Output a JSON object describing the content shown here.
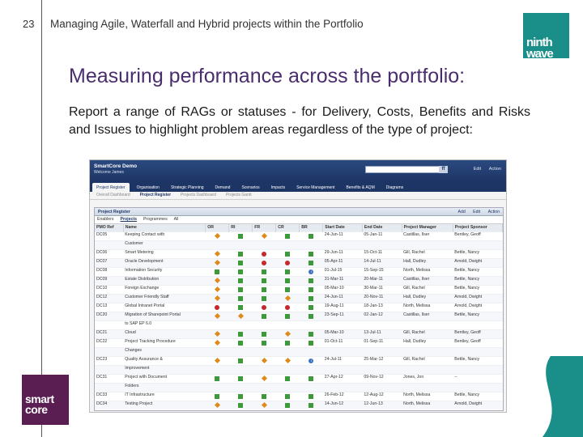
{
  "slide": {
    "page_number": "23",
    "header": "Managing Agile, Waterfall and Hybrid projects within the Portfolio",
    "title": "Measuring performance across the portfolio:",
    "intro": "Report a range of RAGs or statuses - for Delivery, Costs, Benefits and Risks and Issues to highlight problem areas regardless of the type of project:",
    "brand_right": [
      "ninth",
      "wave"
    ],
    "brand_left": [
      "smart",
      "core"
    ],
    "colors": {
      "title": "#4a2d6d",
      "brand_right": "#1a8f8a",
      "brand_left": "#5a1e52"
    }
  },
  "app": {
    "title": "SmartCore Demo",
    "welcome": "Welcome James",
    "search_placeholder": "",
    "search_button": "ff",
    "top_links": [
      "Edit",
      "Action"
    ],
    "nav": [
      "Project Register",
      "Organisation",
      "Strategic Planning",
      "Demand",
      "Scenarios",
      "Impacts",
      "Service Management",
      "Benefits & AQM",
      "Diagrams"
    ],
    "nav_active": 0,
    "subnav": [
      "Overall Dashboard",
      "Project Register",
      "Projects Dashboard",
      "Projects Gantt"
    ],
    "subnav_active": 1,
    "panel_title": "Project Register",
    "panel_actions": [
      "Add",
      "Edit",
      "Action"
    ],
    "filter_tabs": [
      "Enablers",
      "Projects",
      "Programmes",
      "All"
    ],
    "filter_active": 1,
    "columns": [
      "PMO Ref",
      "Name",
      "OR",
      "RI",
      "FR",
      "CR",
      "BR",
      "Start Date",
      "End Date",
      "Project Manager",
      "Project Sponsor"
    ],
    "rows": [
      {
        "ref": "DC05",
        "name": "Keeping Contact with",
        "rag": [
          "amber",
          "green",
          "amber",
          "green",
          "green"
        ],
        "start": "24-Jun-11",
        "end": "05-Jan-11",
        "pm": "Castillas, Ilser",
        "sponsor": "Bentley, Geoff"
      },
      {
        "ref": "",
        "name": "Customer",
        "rag": [
          "none",
          "none",
          "none",
          "none",
          "none"
        ],
        "start": "",
        "end": "",
        "pm": "",
        "sponsor": ""
      },
      {
        "ref": "DC06",
        "name": "Smart Metering",
        "rag": [
          "amber",
          "green",
          "red",
          "green",
          "green"
        ],
        "start": "29-Jun-11",
        "end": "15-Oct-11",
        "pm": "Gill, Rachel",
        "sponsor": "Bettle, Nancy"
      },
      {
        "ref": "DC07",
        "name": "Oracle Development",
        "rag": [
          "amber",
          "green",
          "red",
          "red",
          "green"
        ],
        "start": "05-Apr-11",
        "end": "14-Jul-11",
        "pm": "Hall, Dudley",
        "sponsor": "Arnold, Dwight"
      },
      {
        "ref": "DC08",
        "name": "Information Security",
        "rag": [
          "green",
          "green",
          "green",
          "green",
          "info"
        ],
        "start": "01-Jul-15",
        "end": "15-Sep-15",
        "pm": "North, Melissa",
        "sponsor": "Bettle, Nancy"
      },
      {
        "ref": "DC09",
        "name": "Estate Distribution",
        "rag": [
          "amber",
          "green",
          "green",
          "green",
          "green"
        ],
        "start": "31-Mar-11",
        "end": "20-Mar-11",
        "pm": "Castillas, Ilser",
        "sponsor": "Bettle, Nancy"
      },
      {
        "ref": "DC10",
        "name": "Foreign Exchange",
        "rag": [
          "amber",
          "green",
          "green",
          "green",
          "green"
        ],
        "start": "05-Mar-10",
        "end": "30-Mar-11",
        "pm": "Gill, Rachel",
        "sponsor": "Bettle, Nancy"
      },
      {
        "ref": "DC12",
        "name": "Customer Friendly Staff",
        "rag": [
          "amber",
          "green",
          "green",
          "amber",
          "green"
        ],
        "start": "24-Jun-11",
        "end": "20-Nov-11",
        "pm": "Hall, Dudley",
        "sponsor": "Arnold, Dwight"
      },
      {
        "ref": "DC13",
        "name": "Global Intranet Portal",
        "rag": [
          "red",
          "green",
          "red",
          "red",
          "green"
        ],
        "start": "19-Aug-11",
        "end": "18-Jan-13",
        "pm": "North, Melissa",
        "sponsor": "Arnold, Dwight"
      },
      {
        "ref": "DC20",
        "name": "Migration of Sharepoint Portal",
        "rag": [
          "amber",
          "amber",
          "green",
          "green",
          "green"
        ],
        "start": "23-Sep-11",
        "end": "02-Jan-12",
        "pm": "Castillas, Ilser",
        "sponsor": "Bettle, Nancy"
      },
      {
        "ref": "",
        "name": "to SAP EP 6.0",
        "rag": [
          "none",
          "none",
          "none",
          "none",
          "none"
        ],
        "start": "",
        "end": "",
        "pm": "",
        "sponsor": ""
      },
      {
        "ref": "DC21",
        "name": "Cloud",
        "rag": [
          "amber",
          "green",
          "green",
          "amber",
          "green"
        ],
        "start": "05-Mar-10",
        "end": "13-Jul-11",
        "pm": "Gill, Rachel",
        "sponsor": "Bentley, Geoff"
      },
      {
        "ref": "DC22",
        "name": "Project Tracking Procedure",
        "rag": [
          "amber",
          "green",
          "green",
          "green",
          "green"
        ],
        "start": "01-Oct-11",
        "end": "01-Sep-11",
        "pm": "Hall, Dudley",
        "sponsor": "Bentley, Geoff"
      },
      {
        "ref": "",
        "name": "Changes",
        "rag": [
          "none",
          "none",
          "none",
          "none",
          "none"
        ],
        "start": "",
        "end": "",
        "pm": "",
        "sponsor": ""
      },
      {
        "ref": "DC23",
        "name": "Quality Assurance &",
        "rag": [
          "amber",
          "green",
          "amber",
          "amber",
          "info"
        ],
        "start": "24-Jul-11",
        "end": "25-Mar-12",
        "pm": "Gill, Rachel",
        "sponsor": "Bettle, Nancy"
      },
      {
        "ref": "",
        "name": "Improvement",
        "rag": [
          "none",
          "none",
          "none",
          "none",
          "none"
        ],
        "start": "",
        "end": "",
        "pm": "",
        "sponsor": ""
      },
      {
        "ref": "DC31",
        "name": "Project with Document",
        "rag": [
          "green",
          "green",
          "amber",
          "green",
          "green"
        ],
        "start": "27-Apr-12",
        "end": "09-Nov-12",
        "pm": "Jones, Jon",
        "sponsor": "--"
      },
      {
        "ref": "",
        "name": "Folders",
        "rag": [
          "none",
          "none",
          "none",
          "none",
          "none"
        ],
        "start": "",
        "end": "",
        "pm": "",
        "sponsor": ""
      },
      {
        "ref": "DC33",
        "name": "IT Infrastructure",
        "rag": [
          "green",
          "green",
          "green",
          "green",
          "green"
        ],
        "start": "26-Feb-12",
        "end": "12-Aug-12",
        "pm": "North, Melissa",
        "sponsor": "Bettle, Nancy"
      },
      {
        "ref": "DC34",
        "name": "Testing Project",
        "rag": [
          "amber",
          "green",
          "amber",
          "green",
          "green"
        ],
        "start": "14-Jun-12",
        "end": "12-Jun-13",
        "pm": "North, Melissa",
        "sponsor": "Arnold, Dwight"
      }
    ]
  }
}
